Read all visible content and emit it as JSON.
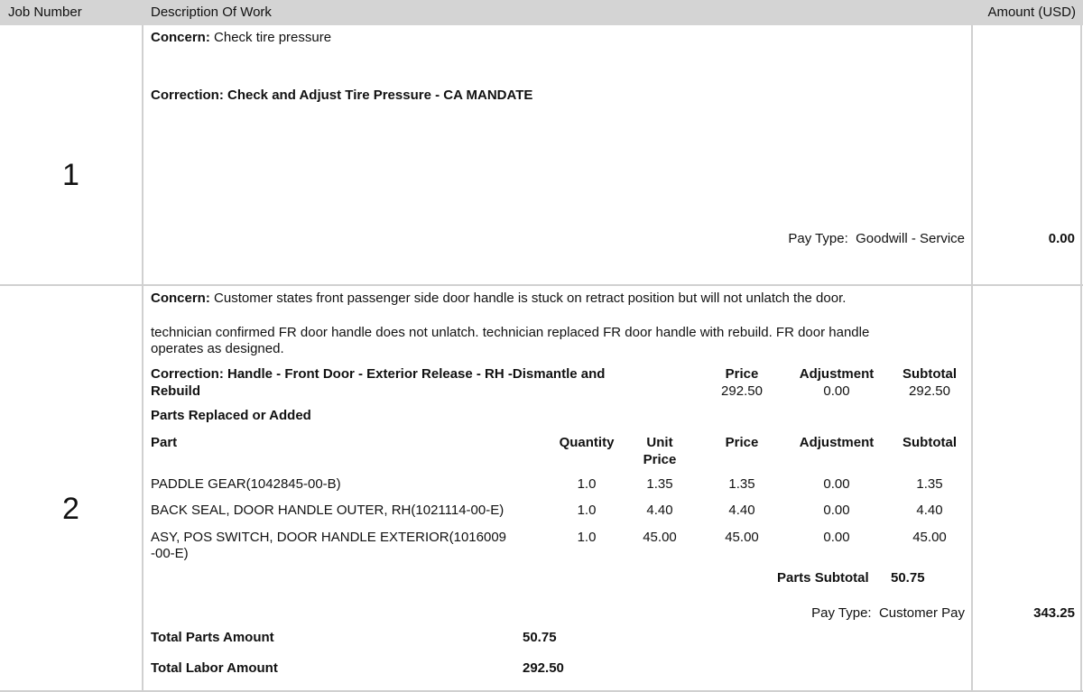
{
  "header": {
    "job_number": "Job Number",
    "description": "Description Of Work",
    "amount": "Amount (USD)"
  },
  "job1": {
    "number": "1",
    "concern_label": "Concern:",
    "concern_text": "Check tire pressure",
    "correction": "Correction: Check and Adjust Tire Pressure - CA MANDATE",
    "pay_type_label": "Pay Type:",
    "pay_type_value": "Goodwill - Service",
    "amount": "0.00"
  },
  "job2": {
    "number": "2",
    "concern_label": "Concern:",
    "concern_text": "Customer states front passenger side door handle is stuck on retract position but will not unlatch the door.",
    "tech_note_line1": "technician confirmed FR door handle does not unlatch. technician replaced FR door handle with rebuild. FR door handle",
    "tech_note_line2": "operates as designed.",
    "correction_line1": "Correction: Handle - Front Door - Exterior Release - RH -Dismantle and",
    "correction_line2": "Rebuild",
    "labor_headers": {
      "price": "Price",
      "adjustment": "Adjustment",
      "subtotal": "Subtotal"
    },
    "labor_values": {
      "price": "292.50",
      "adjustment": "0.00",
      "subtotal": "292.50"
    },
    "parts_title": "Parts Replaced or Added",
    "parts_headers": {
      "part": "Part",
      "quantity": "Quantity",
      "unit_price_line1": "Unit",
      "unit_price_line2": "Price",
      "price": "Price",
      "adjustment": "Adjustment",
      "subtotal": "Subtotal"
    },
    "parts": [
      {
        "name": "PADDLE GEAR(1042845-00-B)",
        "name2": "",
        "qty": "1.0",
        "unit": "1.35",
        "price": "1.35",
        "adj": "0.00",
        "subtotal": "1.35"
      },
      {
        "name": "BACK SEAL, DOOR HANDLE OUTER, RH(1021114-00-E)",
        "name2": "",
        "qty": "1.0",
        "unit": "4.40",
        "price": "4.40",
        "adj": "0.00",
        "subtotal": "4.40"
      },
      {
        "name": "ASY, POS SWITCH, DOOR HANDLE EXTERIOR(1016009",
        "name2": "-00-E)",
        "qty": "1.0",
        "unit": "45.00",
        "price": "45.00",
        "adj": "0.00",
        "subtotal": "45.00"
      }
    ],
    "parts_subtotal_label": "Parts Subtotal",
    "parts_subtotal_value": "50.75",
    "pay_type_label": "Pay Type:",
    "pay_type_value": "Customer Pay",
    "amount": "343.25",
    "total_parts_label": "Total Parts Amount",
    "total_parts_value": "50.75",
    "total_labor_label": "Total Labor Amount",
    "total_labor_value": "292.50"
  }
}
